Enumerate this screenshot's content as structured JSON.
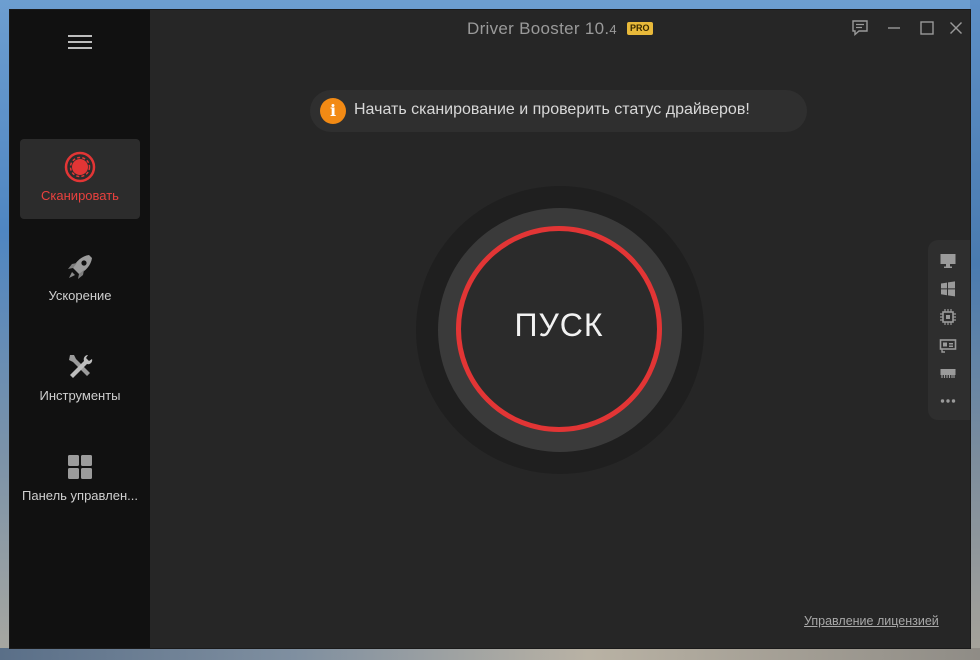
{
  "window": {
    "title_main": "Driver Booster 10.",
    "title_minor": "4",
    "badge": "PRO"
  },
  "sidebar": {
    "items": [
      {
        "label": "Сканировать",
        "icon": "scan-target-icon",
        "active": true
      },
      {
        "label": "Ускорение",
        "icon": "rocket-icon",
        "active": false
      },
      {
        "label": "Инструменты",
        "icon": "tools-icon",
        "active": false
      },
      {
        "label": "Панель управлен...",
        "icon": "dashboard-grid-icon",
        "active": false
      }
    ]
  },
  "banner": {
    "icon_glyph": "i",
    "text": "Начать сканирование и проверить статус драйверов!"
  },
  "scan_button": {
    "label": "ПУСК"
  },
  "side_panel": {
    "icons": [
      "monitor-icon",
      "windows-icon",
      "chip-icon",
      "network-card-icon",
      "memory-icon",
      "more-icon"
    ]
  },
  "footer": {
    "license_link": "Управление лицензией"
  },
  "colors": {
    "accent_red": "#e23535",
    "active_label": "#e8413e",
    "info_orange": "#f28a14",
    "pro_gold": "#e8b93a",
    "sidebar_bg": "#111111",
    "main_bg": "#262626"
  }
}
